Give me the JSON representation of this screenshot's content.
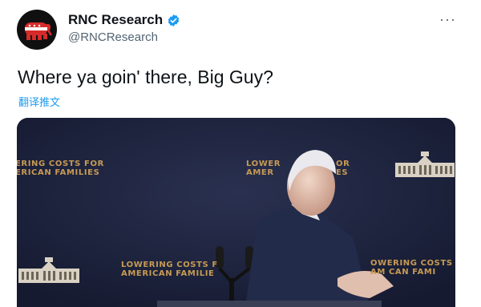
{
  "account": {
    "display_name": "RNC Research",
    "handle": "@RNCResearch",
    "verified": true,
    "avatar_icon": "gop-elephant-icon",
    "avatar_color": "#d62b2b"
  },
  "menu": {
    "more_label": "···"
  },
  "tweet": {
    "text": "Where ya goin' there, Big Guy?",
    "translate_label": "翻译推文"
  },
  "media": {
    "banners": [
      {
        "line1": "ERING COSTS FOR",
        "line2": "ERICAN FAMILIES"
      },
      {
        "line1": "LOWER",
        "line2": "AMER"
      },
      {
        "line1": "OR",
        "line2": "ES"
      },
      {
        "line1": "LOWERING COSTS F",
        "line2": "AMERICAN FAMILIE"
      },
      {
        "line1": "OWERING COSTS",
        "line2": "AM   CAN FAMI"
      }
    ],
    "emblem_icon": "white-house-icon",
    "accent_color": "#c79a55"
  },
  "colors": {
    "link": "#1d9bf0",
    "verified": "#1d9bf0",
    "muted": "#536471"
  }
}
